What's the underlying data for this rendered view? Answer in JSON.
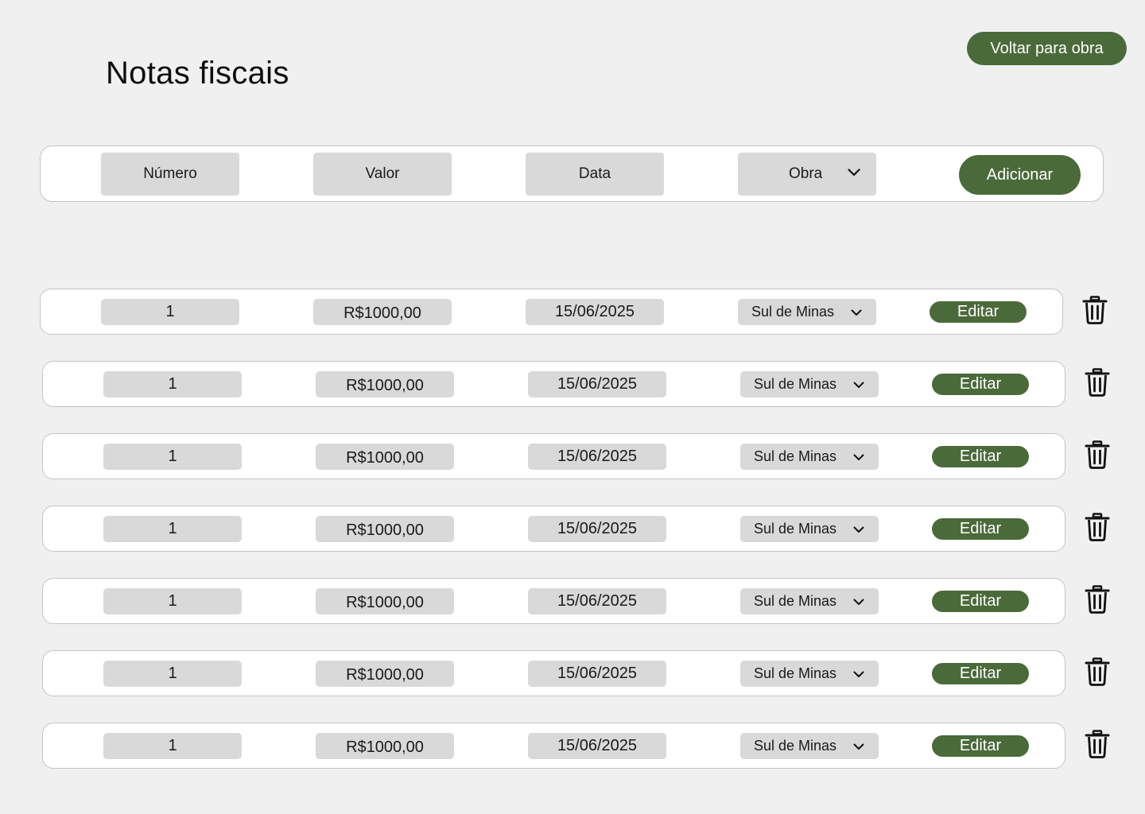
{
  "header": {
    "title": "Notas fiscais",
    "back_label": "Voltar para obra"
  },
  "toolbar": {
    "numero_label": "Número",
    "valor_label": "Valor",
    "data_label": "Data",
    "obra_label": "Obra",
    "add_label": "Adicionar"
  },
  "rows": [
    {
      "numero": "1",
      "valor": "R$1000,00",
      "data": "15/06/2025",
      "obra": "Sul de Minas",
      "edit_label": "Editar"
    },
    {
      "numero": "1",
      "valor": "R$1000,00",
      "data": "15/06/2025",
      "obra": "Sul de Minas",
      "edit_label": "Editar"
    },
    {
      "numero": "1",
      "valor": "R$1000,00",
      "data": "15/06/2025",
      "obra": "Sul de Minas",
      "edit_label": "Editar"
    },
    {
      "numero": "1",
      "valor": "R$1000,00",
      "data": "15/06/2025",
      "obra": "Sul de Minas",
      "edit_label": "Editar"
    },
    {
      "numero": "1",
      "valor": "R$1000,00",
      "data": "15/06/2025",
      "obra": "Sul de Minas",
      "edit_label": "Editar"
    },
    {
      "numero": "1",
      "valor": "R$1000,00",
      "data": "15/06/2025",
      "obra": "Sul de Minas",
      "edit_label": "Editar"
    },
    {
      "numero": "1",
      "valor": "R$1000,00",
      "data": "15/06/2025",
      "obra": "Sul de Minas",
      "edit_label": "Editar"
    }
  ],
  "icons": {
    "dropdown": "chevron-down-icon",
    "delete": "trash-icon"
  },
  "colors": {
    "background": "#f0f0f0",
    "accent_green": "#4a6a3a",
    "field_gray": "#d9d9d9",
    "card_white": "#ffffff",
    "border": "#c4c4c4"
  }
}
